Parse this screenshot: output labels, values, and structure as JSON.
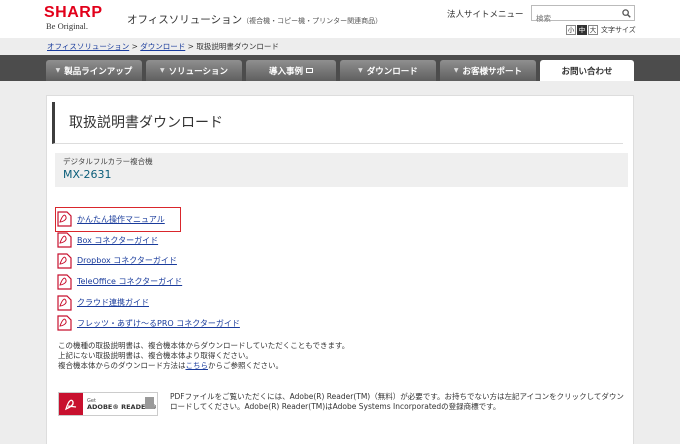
{
  "header": {
    "brand": "SHARP",
    "tagline": "Be Original.",
    "site_title": "オフィスソリューション",
    "site_subtitle": "（複合機・コピー機・プリンター関連商品）",
    "corp_link": "法人サイトメニュー",
    "search_placeholder": "検索",
    "font_sizes": [
      "小",
      "中",
      "大"
    ],
    "font_size_label": "文字サイズ"
  },
  "breadcrumb": {
    "items": [
      "オフィスソリューション",
      "ダウンロード"
    ],
    "current": "取扱説明書ダウンロード",
    "sep": ">"
  },
  "nav": {
    "tabs": [
      "製品ラインアップ",
      "ソリューション",
      "導入事例",
      "ダウンロード",
      "お客様サポート",
      "お問い合わせ"
    ]
  },
  "page": {
    "title": "取扱説明書ダウンロード",
    "category": "デジタルフルカラー複合機",
    "model": "MX-2631"
  },
  "documents": [
    "かんたん操作マニュアル",
    "Box コネクターガイド",
    "Dropbox コネクターガイド",
    "TeleOffice コネクターガイド",
    "クラウド連携ガイド",
    "フレッツ・あずけ～るPRO コネクターガイド"
  ],
  "notes": {
    "line1": "この機種の取扱説明書は、複合機本体からダウンロードしていただくこともできます。",
    "line2": "上記にない取扱説明書は、複合機本体より取得ください。",
    "line3_pre": "複合機本体からのダウンロード方法は",
    "line3_link": "こちら",
    "line3_post": "からご参照ください。"
  },
  "adobe": {
    "get": "Get",
    "name": "ADOBE® READER®",
    "note": "PDFファイルをご覧いただくには、Adobe(R) Reader(TM)（無料）が必要です。お持ちでない方は左記アイコンをクリックしてダウンロードしてください。Adobe(R) Reader(TM)はAdobe Systems Incorporatedの登録商標です。"
  },
  "colors": {
    "brand_red": "#e2001a",
    "nav_bg": "#4c4c4c",
    "link": "#1a3c9c",
    "model": "#0b5e7a",
    "highlight": "#d9262c"
  }
}
